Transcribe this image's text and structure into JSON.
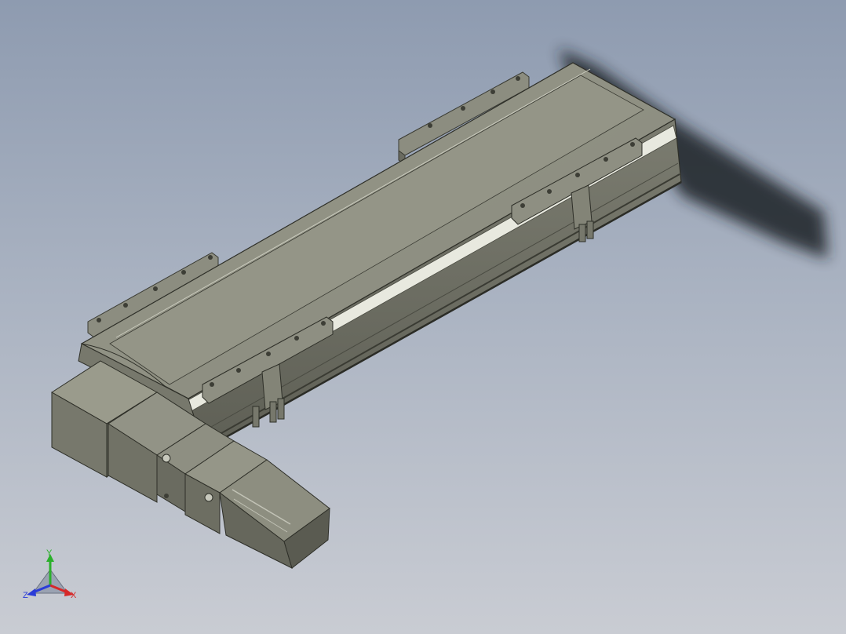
{
  "viewport": {
    "background_top": "#8e9bb0",
    "background_bottom": "#c9ccd3",
    "model_name": "linear-actuator-with-servo-motor"
  },
  "model": {
    "body_color": "#8a8b7d",
    "body_dark": "#6f7064",
    "body_light": "#a4a596",
    "shadow_color": "#1e2126"
  },
  "triad": {
    "x_label": "X",
    "y_label": "Y",
    "z_label": "Z",
    "x_color": "#d62828",
    "y_color": "#2bb02b",
    "z_color": "#2a3bd8"
  }
}
